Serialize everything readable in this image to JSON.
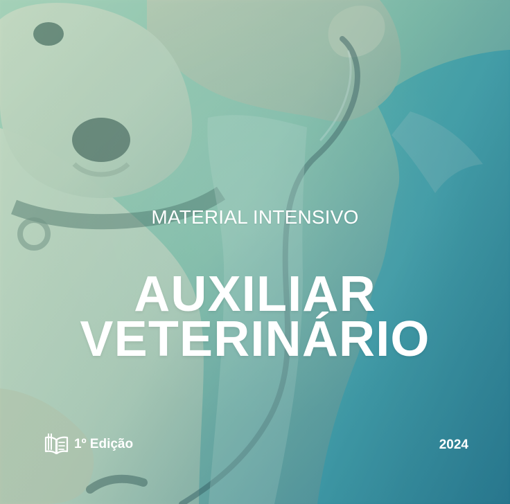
{
  "cover": {
    "subtitle": "MATERIAL INTENSIVO",
    "title_line_1": "AUXILIAR",
    "title_line_2": "VETERINÁRIO",
    "edition": "1º Edição",
    "year": "2024"
  },
  "icons": {
    "edition_icon": "open-book-icon"
  },
  "colors": {
    "text": "#FFFFFF",
    "mint_overlay": "#9BCAB2",
    "teal_overlay": "#3A8490",
    "dog_fur": "#E9E5D5",
    "scrubs": "#2F8EAA"
  }
}
